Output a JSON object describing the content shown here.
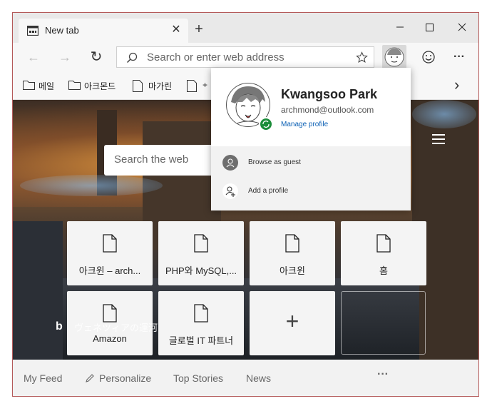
{
  "tab": {
    "title": "New tab",
    "close_glyph": "✕"
  },
  "toolbar": {
    "new_tab_glyph": "+",
    "back_glyph": "←",
    "forward_glyph": "→",
    "refresh_glyph": "↻",
    "address_placeholder": "Search or enter web address",
    "more_glyph": "···"
  },
  "favorites": {
    "items": [
      {
        "label": "메일",
        "icon": "folder-icon"
      },
      {
        "label": "아크몬드",
        "icon": "folder-icon"
      },
      {
        "label": "마가린",
        "icon": "page-icon"
      },
      {
        "label": "+",
        "icon": "page-icon"
      }
    ],
    "chevron_glyph": "›"
  },
  "newtab": {
    "search_placeholder": "Search the web",
    "tiles": [
      {
        "label": "아크윈 – arch..."
      },
      {
        "label": "PHP와 MySQL,..."
      },
      {
        "label": "아크윈"
      },
      {
        "label": "홈"
      },
      {
        "label": "Amazon"
      },
      {
        "label": "글로벌 IT 파트너"
      }
    ],
    "add_glyph": "+",
    "bing_logo": "b",
    "bing_caption": "ヴェネツィアの運河"
  },
  "footer": {
    "my_feed": "My Feed",
    "personalize": "Personalize",
    "top_stories": "Top Stories",
    "news": "News",
    "more_glyph": "···"
  },
  "profile": {
    "name": "Kwangsoo Park",
    "email": "archmond@outlook.com",
    "manage": "Manage profile",
    "browse_guest": "Browse as guest",
    "add_profile": "Add a profile"
  },
  "colors": {
    "accent": "#0a5fb4",
    "sync_green": "#1c8d3a",
    "window_border": "#b45a5a"
  }
}
